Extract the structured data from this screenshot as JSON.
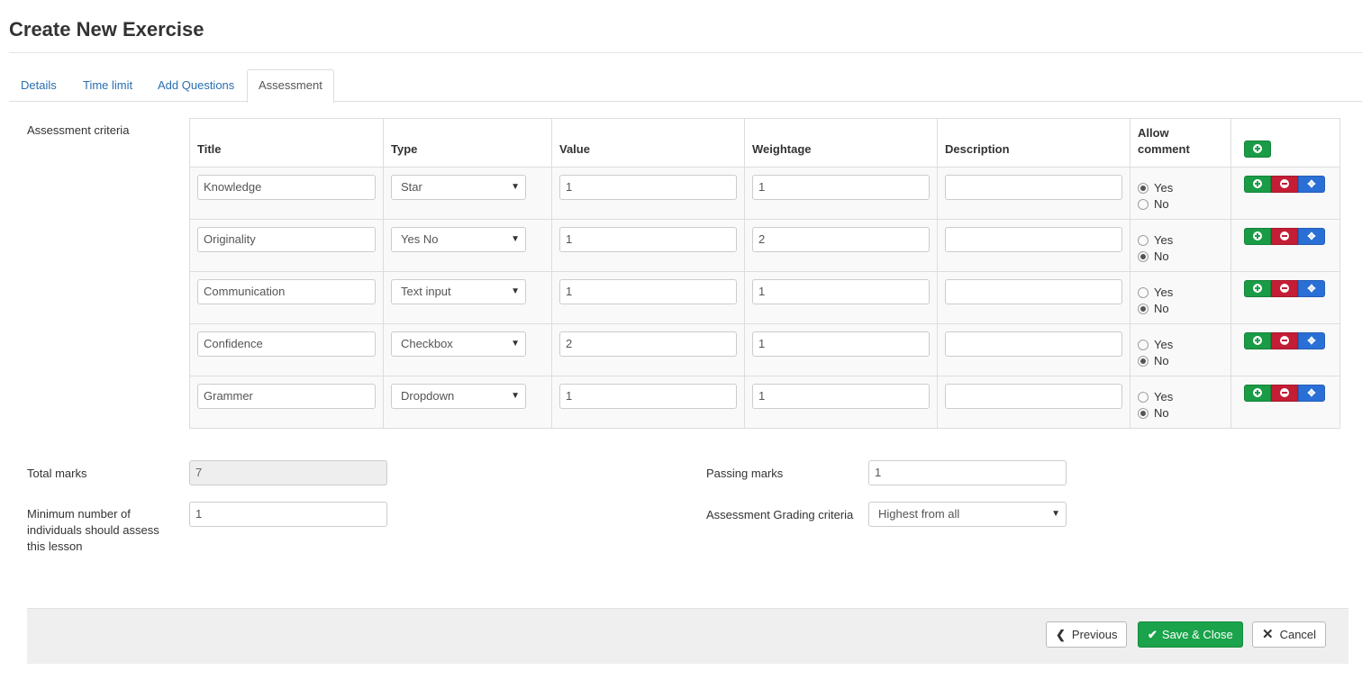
{
  "page": {
    "title": "Create New Exercise"
  },
  "tabs": [
    {
      "label": "Details",
      "active": false
    },
    {
      "label": "Time limit",
      "active": false
    },
    {
      "label": "Add Questions",
      "active": false
    },
    {
      "label": "Assessment",
      "active": true
    }
  ],
  "assessment": {
    "section_label": "Assessment criteria",
    "columns": {
      "title": "Title",
      "type": "Type",
      "value": "Value",
      "weightage": "Weightage",
      "description": "Description",
      "allow_comment": "Allow comment"
    },
    "radio_labels": {
      "yes": "Yes",
      "no": "No"
    },
    "rows": [
      {
        "title": "Knowledge",
        "type": "Star",
        "value": "1",
        "weightage": "1",
        "description": "",
        "allow_comment": "Yes"
      },
      {
        "title": "Originality",
        "type": "Yes No",
        "value": "1",
        "weightage": "2",
        "description": "",
        "allow_comment": "No"
      },
      {
        "title": "Communication",
        "type": "Text input",
        "value": "1",
        "weightage": "1",
        "description": "",
        "allow_comment": "No"
      },
      {
        "title": "Confidence",
        "type": "Checkbox",
        "value": "2",
        "weightage": "1",
        "description": "",
        "allow_comment": "No"
      },
      {
        "title": "Grammer",
        "type": "Dropdown",
        "value": "1",
        "weightage": "1",
        "description": "",
        "allow_comment": "No"
      }
    ]
  },
  "form": {
    "total_marks_label": "Total marks",
    "total_marks_value": "7",
    "passing_marks_label": "Passing marks",
    "passing_marks_value": "1",
    "min_individuals_label": "Minimum number of individuals should assess this lesson",
    "min_individuals_value": "1",
    "grading_label": "Assessment Grading criteria",
    "grading_value": "Highest from all"
  },
  "footer": {
    "previous_label": "Previous",
    "save_close_label": "Save & Close",
    "cancel_label": "Cancel"
  },
  "colors": {
    "link": "#2a6fb0",
    "add_green": "#1a9b46",
    "remove_red": "#c41d36",
    "move_blue": "#2a6fd6",
    "save_green": "#1aa34a"
  }
}
